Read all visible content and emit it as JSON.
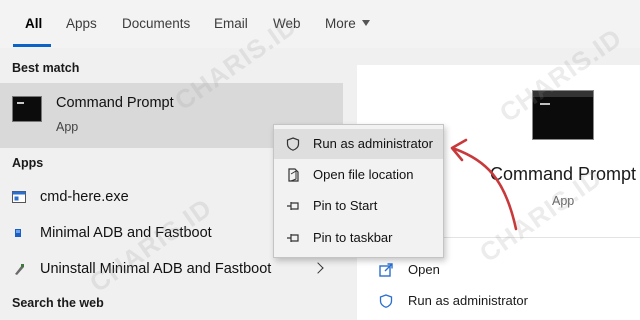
{
  "tabs": [
    {
      "label": "All",
      "active": true
    },
    {
      "label": "Apps"
    },
    {
      "label": "Documents"
    },
    {
      "label": "Email"
    },
    {
      "label": "Web"
    },
    {
      "label": "More"
    }
  ],
  "best_match": {
    "section_title": "Best match",
    "name": "Command Prompt",
    "type": "App",
    "icon": "command-prompt-icon"
  },
  "apps": {
    "section_title": "Apps",
    "items": [
      {
        "label": "cmd-here.exe",
        "icon": "exe-window-icon"
      },
      {
        "label": "Minimal ADB and Fastboot",
        "icon": "app-icon"
      },
      {
        "label": "Uninstall Minimal ADB and Fastboot",
        "icon": "uninstall-icon",
        "has_submenu": true
      }
    ]
  },
  "search_web": {
    "section_title": "Search the web"
  },
  "context_menu": {
    "items": [
      {
        "label": "Run as administrator",
        "icon": "shield-icon",
        "highlighted": true
      },
      {
        "label": "Open file location",
        "icon": "file-icon"
      },
      {
        "label": "Pin to Start",
        "icon": "pin-icon"
      },
      {
        "label": "Pin to taskbar",
        "icon": "pin-icon"
      }
    ]
  },
  "detail": {
    "name": "Command Prompt",
    "type": "App",
    "actions": [
      {
        "label": "Open",
        "icon": "open-icon"
      },
      {
        "label": "Run as administrator",
        "icon": "shield-icon"
      }
    ]
  },
  "watermark": "CHARIS.ID",
  "colors": {
    "accent": "#0a64c8",
    "selected_row": "#d9d9d9",
    "pane_bg": "#f0f0f0",
    "annotation_arrow": "#c8393b"
  }
}
